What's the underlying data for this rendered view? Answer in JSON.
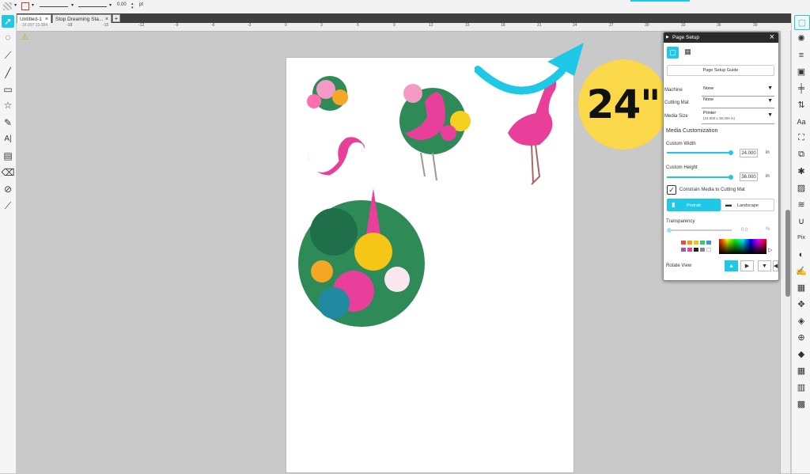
{
  "options_bar": {
    "stroke_value": "0.00",
    "stroke_unit": "pt"
  },
  "tabs": [
    {
      "label": "Untitled-1",
      "close": "×"
    },
    {
      "label": "Stop Dreaming Sta...",
      "close": "×"
    }
  ],
  "new_tab": "+",
  "ruler": {
    "readout": "16.097  13.384",
    "h_ticks": [
      "-18",
      "-15",
      "-12",
      "-9",
      "-6",
      "-3",
      "0",
      "3",
      "6",
      "9",
      "12",
      "15",
      "18",
      "21",
      "24",
      "27",
      "30",
      "33",
      "36",
      "39"
    ]
  },
  "panel": {
    "title": "Page Setup",
    "close": "×",
    "guide_button": "Page Setup Guide",
    "machine_label": "Machine",
    "machine_value": "None",
    "mat_label": "Cutting Mat",
    "mat_value": "None",
    "media_label": "Media Size",
    "media_value": "Printer",
    "media_sub": "(24.000 x 36.000 in)",
    "customization_header": "Media Customization",
    "width_label": "Custom Width",
    "width_value": "24.000",
    "height_label": "Custom Height",
    "height_value": "36.000",
    "unit": "in",
    "constrain_label": "Constrain Media to Cutting Mat",
    "portrait_label": "Portrait",
    "landscape_label": "Landscape",
    "transparency_label": "Transparency",
    "transparency_value": "0.0",
    "transparency_unit": "%",
    "rotate_label": "Rotate View",
    "swatches": [
      "#e74c3c",
      "#f39c12",
      "#f1c40f",
      "#2ecc71",
      "#3498db",
      "#9b59b6",
      "#e84393",
      "#222222",
      "#888888",
      "#ffffff"
    ]
  },
  "annotation": {
    "badge_text": "24\"",
    "arrow_color": "#1ec8e6",
    "badge_color": "#fbd84a"
  },
  "colors": {
    "accent": "#1ec8e6",
    "pink": "#e8409a"
  }
}
